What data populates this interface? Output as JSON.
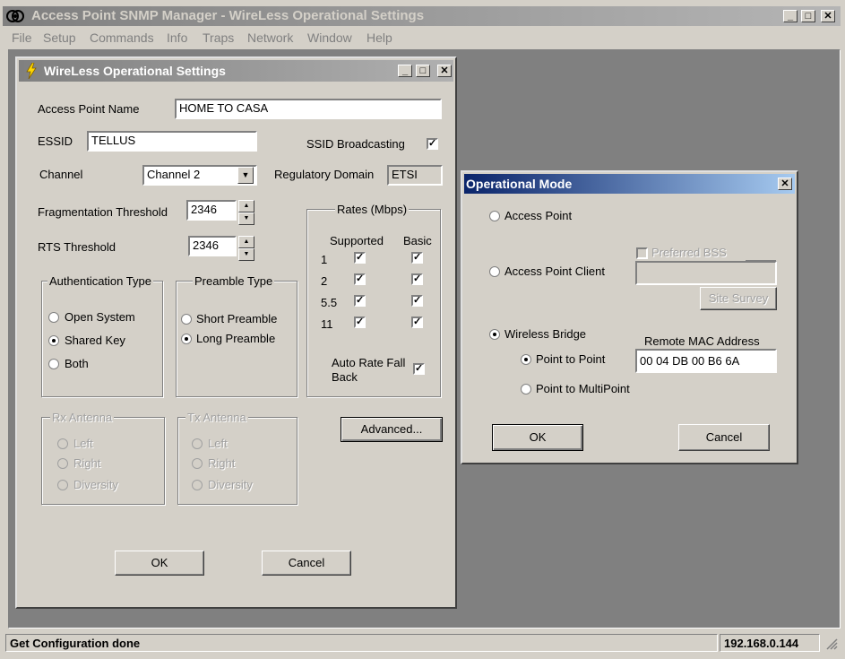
{
  "app": {
    "title": "Access Point SNMP Manager -  WireLess Operational Settings",
    "menu": [
      "File",
      "Setup",
      "Commands",
      "Info",
      "Traps",
      "Network",
      "Window",
      "Help"
    ]
  },
  "status": {
    "message": "Get Configuration done",
    "ip": "192.168.0.144"
  },
  "wireless": {
    "title": "WireLess Operational Settings",
    "ap_name_label": "Access Point Name",
    "ap_name_value": "HOME TO CASA",
    "essid_label": "ESSID",
    "essid_value": "TELLUS",
    "ssid_broadcast_label": "SSID Broadcasting",
    "channel_label": "Channel",
    "channel_value": "Channel 2",
    "reg_domain_label": "Regulatory Domain",
    "reg_domain_value": "ETSI",
    "frag_label": "Fragmentation Threshold",
    "frag_value": "2346",
    "rts_label": "RTS Threshold",
    "rts_value": "2346",
    "rates": {
      "title": "Rates (Mbps)",
      "supported_label": "Supported",
      "basic_label": "Basic",
      "rows": [
        "1",
        "2",
        "5.5",
        "11"
      ],
      "auto_fallback_label": "Auto Rate Fall Back"
    },
    "auth": {
      "title": "Authentication Type",
      "options": [
        "Open System",
        "Shared Key",
        "Both"
      ],
      "selected": "Shared Key"
    },
    "preamble": {
      "title": "Preamble Type",
      "options": [
        "Short Preamble",
        "Long Preamble"
      ],
      "selected": "Long Preamble"
    },
    "rx_antenna": {
      "title": "Rx Antenna",
      "options": [
        "Left",
        "Right",
        "Diversity"
      ]
    },
    "tx_antenna": {
      "title": "Tx Antenna",
      "options": [
        "Left",
        "Right",
        "Diversity"
      ]
    },
    "advanced_label": "Advanced...",
    "ok_label": "OK",
    "cancel_label": "Cancel"
  },
  "opmode": {
    "title": "Operational Mode",
    "access_point_label": "Access Point",
    "access_point_client_label": "Access Point Client",
    "preferred_bss_label": "Preferred BSS",
    "site_survey_label": "Site Survey",
    "wireless_bridge_label": "Wireless Bridge",
    "remote_mac_label": "Remote MAC Address",
    "remote_mac_value": "00 04 DB 00 B6 6A",
    "p2p_label": "Point to Point",
    "p2mp_label": "Point to MultiPoint",
    "ok_label": "OK",
    "cancel_label": "Cancel"
  }
}
